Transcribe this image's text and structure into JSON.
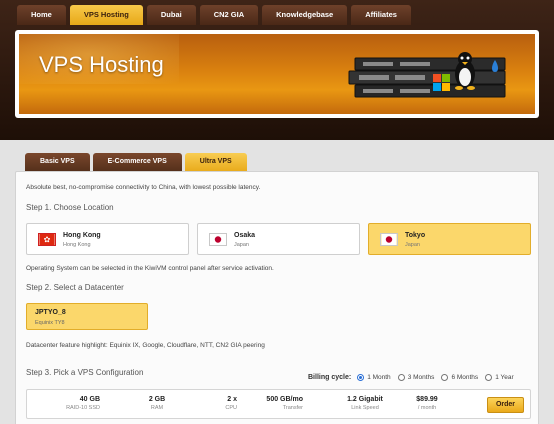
{
  "topnav": [
    {
      "label": "Home",
      "active": false
    },
    {
      "label": "VPS Hosting",
      "active": true
    },
    {
      "label": "Dubai",
      "active": false
    },
    {
      "label": "CN2 GIA",
      "active": false
    },
    {
      "label": "Knowledgebase",
      "active": false
    },
    {
      "label": "Affiliates",
      "active": false
    }
  ],
  "banner": {
    "title": "VPS Hosting"
  },
  "subnav": [
    {
      "label": "Basic VPS",
      "active": false
    },
    {
      "label": "E-Commerce VPS",
      "active": false
    },
    {
      "label": "Ultra VPS",
      "active": true
    }
  ],
  "intro": "Absolute best, no-compromise connectivity to China, with lowest possible latency.",
  "step1": {
    "title": "Step 1. Choose Location",
    "locations": [
      {
        "name": "Hong Kong",
        "country": "Hong Kong",
        "flag": "hk-flag",
        "selected": false
      },
      {
        "name": "Osaka",
        "country": "Japan",
        "flag": "jp-flag",
        "selected": false
      },
      {
        "name": "Tokyo",
        "country": "Japan",
        "flag": "jp-flag",
        "selected": true
      }
    ]
  },
  "os_note": "Operating System can be selected in the KiwiVM control panel after service activation.",
  "step2": {
    "title": "Step 2. Select a Datacenter",
    "datacenter": {
      "name": "JPTYO_8",
      "sub": "Equinix TY8",
      "selected": true
    },
    "highlight": "Datacenter feature highlight: Equinix IX, Google, Cloudflare, NTT, CN2 GIA peering"
  },
  "step3": {
    "title": "Step 3. Pick a VPS Configuration",
    "billing": {
      "label": "Billing cycle:",
      "options": [
        {
          "label": "1 Month",
          "checked": true
        },
        {
          "label": "3 Months",
          "checked": false
        },
        {
          "label": "6 Months",
          "checked": false
        },
        {
          "label": "1 Year",
          "checked": false
        }
      ]
    },
    "plan": {
      "disk": "40 GB",
      "disk_label": "RAID-10 SSD",
      "ram": "2 GB",
      "ram_label": "RAM",
      "cpu": "2 x",
      "cpu_label": "CPU",
      "transfer": "500 GB/mo",
      "transfer_label": "Transfer",
      "link": "1.2 Gigabit",
      "link_label": "Link Speed",
      "price": "$89.99",
      "price_label": "/ month",
      "order_label": "Order"
    }
  },
  "colors": {
    "accent": "#f2bc3a",
    "brown": "#5a3019",
    "selected_bg": "#fbd76b"
  }
}
